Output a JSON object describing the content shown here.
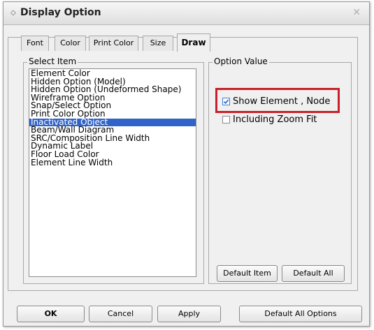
{
  "window": {
    "icon": "diamond-icon",
    "title": "Display Option",
    "close_label": "✕"
  },
  "tabs": [
    {
      "label": "Font"
    },
    {
      "label": "Color"
    },
    {
      "label": "Print Color"
    },
    {
      "label": "Size"
    },
    {
      "label": "Draw",
      "active": true
    }
  ],
  "select_item": {
    "label": "Select Item",
    "items": [
      "Element Color",
      "Hidden Option (Model)",
      "Hidden Option (Undeformed Shape)",
      "Wireframe Option",
      "Snap/Select Option",
      "Print Color Option",
      "Inactivated Object",
      "Beam/Wall Diagram",
      "SRC/Composition Line Width",
      "Dynamic Label",
      "Floor Load Color",
      "Element Line Width"
    ],
    "selected": "Inactivated Object"
  },
  "option_value": {
    "label": "Option Value",
    "show_element_node": {
      "label": "Show Element , Node",
      "checked": true
    },
    "including_zoom_fit": {
      "label": "Including Zoom Fit",
      "checked": false
    },
    "default_item_label": "Default Item",
    "default_all_label": "Default All"
  },
  "footer": {
    "ok_label": "OK",
    "cancel_label": "Cancel",
    "apply_label": "Apply",
    "default_all_options_label": "Default All Options"
  },
  "colors": {
    "selection": "#3164c8",
    "highlight": "#c8202a"
  }
}
